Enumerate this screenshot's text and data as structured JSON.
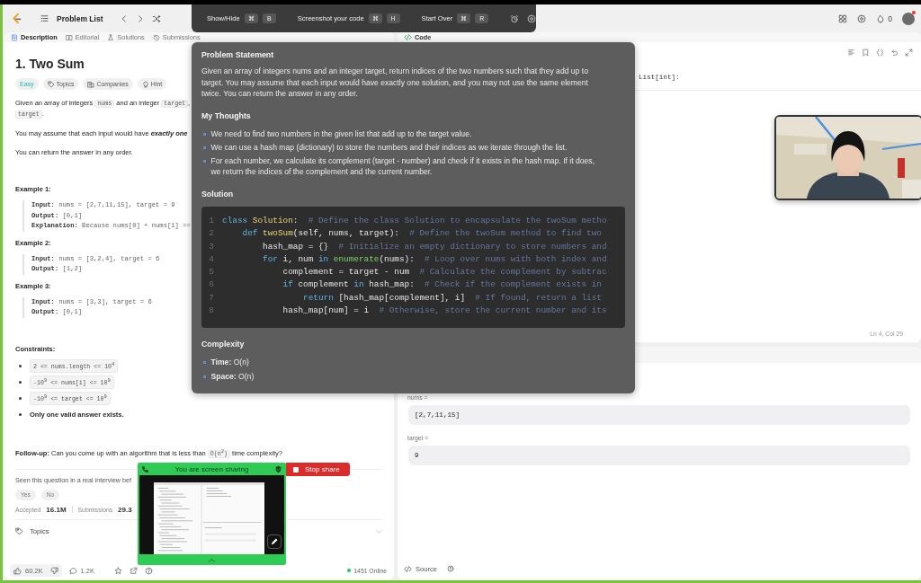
{
  "top_nav": {
    "title": "Problem List",
    "streak": "0"
  },
  "hotkey_bar": [
    {
      "label": "Show/Hide",
      "keys": [
        "⌘",
        "B"
      ]
    },
    {
      "label": "Screenshot your code",
      "keys": [
        "⌘",
        "H"
      ]
    },
    {
      "label": "Start Over",
      "keys": [
        "⌘",
        "R"
      ]
    }
  ],
  "left_tabs": [
    {
      "label": "Description",
      "selected": true
    },
    {
      "label": "Editorial",
      "selected": false
    },
    {
      "label": "Solutions",
      "selected": false
    },
    {
      "label": "Submissions",
      "selected": false
    }
  ],
  "problem": {
    "title": "1. Two Sum",
    "tags": [
      {
        "kind": "difficulty",
        "label": "Easy"
      },
      {
        "kind": "topics",
        "label": "Topics"
      },
      {
        "kind": "companies",
        "label": "Companies"
      },
      {
        "kind": "hint",
        "label": "Hint"
      }
    ],
    "description": [
      [
        {
          "kind": "text",
          "text": "Given an array of integers "
        },
        {
          "kind": "code",
          "text": "nums"
        },
        {
          "kind": "text",
          "text": " and an integer "
        },
        {
          "kind": "code",
          "text": "target"
        },
        {
          "kind": "text",
          "text": ", "
        },
        {
          "kind": "code",
          "text": "target"
        },
        {
          "kind": "text",
          "text": "."
        }
      ],
      [
        {
          "kind": "text",
          "text": "You may assume that each input would have **exactly one**"
        }
      ],
      [
        {
          "kind": "text",
          "text": "You can return the answer in any order."
        }
      ]
    ],
    "examples": [
      {
        "title": "Example 1:",
        "lines": [
          {
            "label": "Input:",
            "value": "nums = [2,7,11,15], target = 9"
          },
          {
            "label": "Output:",
            "value": "[0,1]"
          },
          {
            "label": "Explanation:",
            "value": "Because nums[0] + nums[1] =="
          }
        ]
      },
      {
        "title": "Example 2:",
        "lines": [
          {
            "label": "Input:",
            "value": "nums = [3,2,4], target = 6"
          },
          {
            "label": "Output:",
            "value": "[1,2]"
          }
        ]
      },
      {
        "title": "Example 3:",
        "lines": [
          {
            "label": "Input:",
            "value": "nums = [3,3], target = 6"
          },
          {
            "label": "Output:",
            "value": "[0,1]"
          }
        ]
      }
    ],
    "constraints": {
      "title": "Constraints:",
      "items": [
        {
          "kind": "code",
          "text": "2 <= nums.length <= 10$^{4}$"
        },
        {
          "kind": "code",
          "text": "-10$^{9}$ <= nums[i] <= 10$^{9}$"
        },
        {
          "kind": "code",
          "text": "-10$^{9}$ <= target <= 10$^{9}$"
        },
        {
          "kind": "text",
          "text": "Only one valid answer exists."
        }
      ]
    },
    "follow_up": [
      {
        "kind": "text",
        "text": "**Follow-up:** Can you come up with an algorithm that is less than "
      },
      {
        "kind": "code",
        "text": "O(n$^{2}$)"
      },
      {
        "kind": "text",
        "text": " time complexity?"
      }
    ],
    "feedback": {
      "question": "Seen this question in a real interview bef",
      "options": [
        "Yes",
        "No"
      ]
    },
    "stats": [
      {
        "label": "Accepted",
        "value": "16.1M"
      },
      {
        "label": "Submissions",
        "value": "29.3"
      }
    ],
    "topics": "Topics"
  },
  "footer": {
    "likes": "60.2K",
    "comments": "1.2K",
    "online": "1451 Online"
  },
  "code_panel": {
    "title": "Code",
    "code_line": "List[int]:",
    "cursor": "Ln 4, Col 29"
  },
  "testcase": {
    "fields": [
      {
        "label": "nums =",
        "value": "[2,7,11,15]"
      },
      {
        "label": "target =",
        "value": "9"
      }
    ],
    "source": "Source"
  },
  "notes": {
    "sections": [
      {
        "kind": "paragraph",
        "title": "Problem Statement",
        "text": "Given an array of integers nums and an integer target, return indices of the two numbers such that they add up to target. You may assume that each input would have exactly one solution, and you may not use the same element twice. You can return the answer in any order."
      },
      {
        "kind": "bullets",
        "title": "My Thoughts",
        "items": [
          "We need to find two numbers in the given list that add up to the target value.",
          "We can use a hash map (dictionary) to store the numbers and their indices as we iterate through the list.",
          "For each number, we calculate its complement (target - number) and check if it exists in the hash map. If it does, we return the indices of the complement and the current number."
        ]
      },
      {
        "kind": "code",
        "title": "Solution",
        "lines": [
          {
            "number": "1",
            "tokens": [
              {
                "kind": "keyword",
                "text": "class "
              },
              {
                "kind": "name",
                "text": "Solution"
              },
              {
                "kind": "plain",
                "text": ":  "
              },
              {
                "kind": "comment",
                "text": "# Define the class Solution to encapsulate the twoSum metho"
              }
            ]
          },
          {
            "number": "2",
            "tokens": [
              {
                "kind": "keyword",
                "text": "    def "
              },
              {
                "kind": "name",
                "text": "twoSum"
              },
              {
                "kind": "plain",
                "text": "(self, nums, target):  "
              },
              {
                "kind": "comment",
                "text": "# Define the twoSum method to find two"
              }
            ]
          },
          {
            "number": "3",
            "tokens": [
              {
                "kind": "plain",
                "text": "        hash_map = {}  "
              },
              {
                "kind": "comment",
                "text": "# Initialize an empty dictionary to store numbers and"
              }
            ]
          },
          {
            "number": "4",
            "tokens": [
              {
                "kind": "keyword",
                "text": "        for"
              },
              {
                "kind": "plain",
                "text": " i, num "
              },
              {
                "kind": "keyword",
                "text": "in "
              },
              {
                "kind": "builtin",
                "text": "enumerate"
              },
              {
                "kind": "plain",
                "text": "(nums):  "
              },
              {
                "kind": "comment",
                "text": "# Loop over nums with both index and"
              }
            ]
          },
          {
            "number": "5",
            "tokens": [
              {
                "kind": "plain",
                "text": "            complement = target - num  "
              },
              {
                "kind": "comment",
                "text": "# Calculate the complement by subtrac"
              }
            ]
          },
          {
            "number": "6",
            "tokens": [
              {
                "kind": "keyword",
                "text": "            if"
              },
              {
                "kind": "plain",
                "text": " complement "
              },
              {
                "kind": "keyword",
                "text": "in"
              },
              {
                "kind": "plain",
                "text": " hash_map:  "
              },
              {
                "kind": "comment",
                "text": "# Check if the complement exists in"
              }
            ]
          },
          {
            "number": "7",
            "tokens": [
              {
                "kind": "keyword",
                "text": "                return"
              },
              {
                "kind": "plain",
                "text": " [hash_map[complement], i]  "
              },
              {
                "kind": "comment",
                "text": "# If found, return a list"
              }
            ]
          },
          {
            "number": "8",
            "tokens": [
              {
                "kind": "plain",
                "text": "            hash_map[num] = i  "
              },
              {
                "kind": "comment",
                "text": "# Otherwise, store the current number and its"
              }
            ]
          }
        ]
      },
      {
        "kind": "bullets",
        "title": "Complexity",
        "items": [
          "**Time:** O(n)",
          "**Space:** O(n)"
        ]
      }
    ]
  },
  "screen_share": {
    "banner": "You are screen sharing",
    "stop": "Stop share"
  }
}
